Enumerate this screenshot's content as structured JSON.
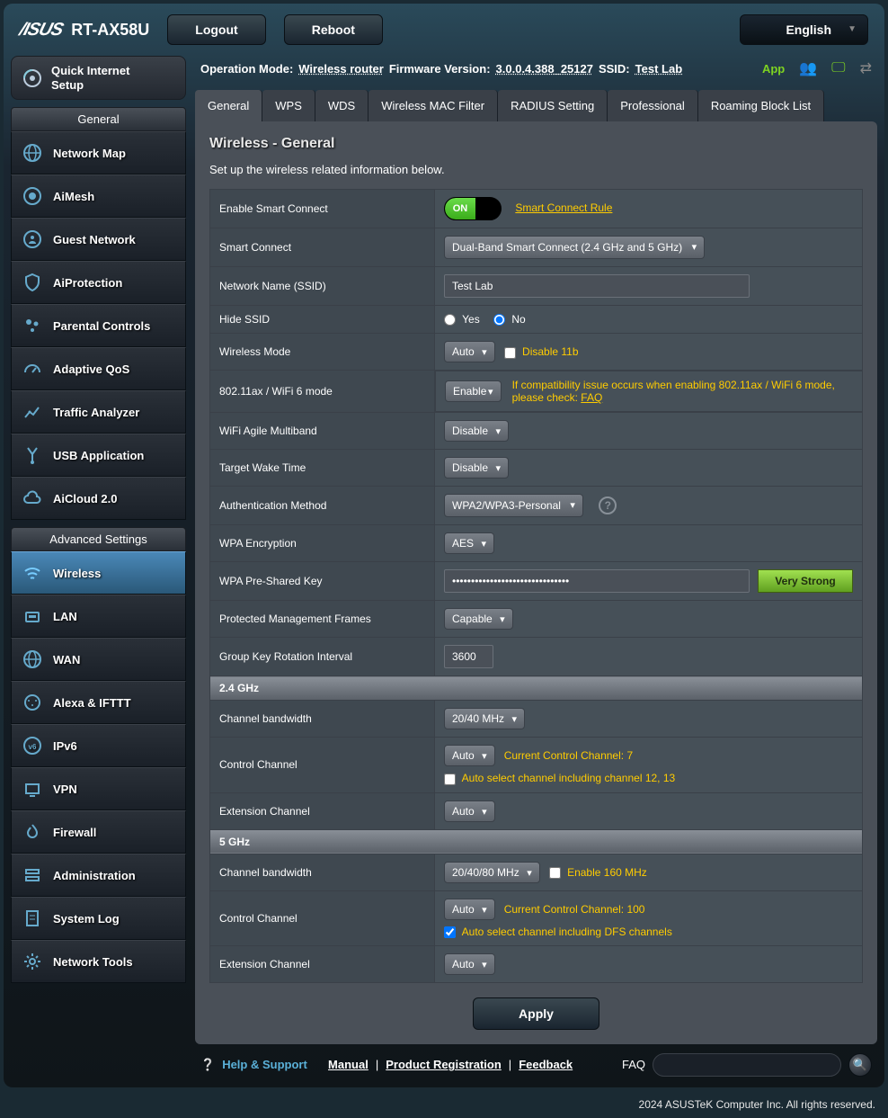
{
  "brand": "/ISUS",
  "model": "RT-AX58U",
  "top": {
    "logout": "Logout",
    "reboot": "Reboot",
    "language": "English"
  },
  "summary": {
    "op_mode_label": "Operation Mode:",
    "op_mode_value": "Wireless router",
    "fw_label": "Firmware Version:",
    "fw_value": "3.0.0.4.388_25127",
    "ssid_label": "SSID:",
    "ssid_value": "Test Lab",
    "app": "App"
  },
  "quick_setup": {
    "line1": "Quick Internet",
    "line2": "Setup"
  },
  "general_header": "General",
  "nav_general": [
    "Network Map",
    "AiMesh",
    "Guest Network",
    "AiProtection",
    "Parental Controls",
    "Adaptive QoS",
    "Traffic Analyzer",
    "USB Application",
    "AiCloud 2.0"
  ],
  "advanced_header": "Advanced Settings",
  "nav_advanced": [
    "Wireless",
    "LAN",
    "WAN",
    "Alexa & IFTTT",
    "IPv6",
    "VPN",
    "Firewall",
    "Administration",
    "System Log",
    "Network Tools"
  ],
  "tabs": [
    "General",
    "WPS",
    "WDS",
    "Wireless MAC Filter",
    "RADIUS Setting",
    "Professional",
    "Roaming Block List"
  ],
  "panel": {
    "title": "Wireless - General",
    "subtitle": "Set up the wireless related information below."
  },
  "form": {
    "enable_sc_label": "Enable Smart Connect",
    "enable_sc_on": "ON",
    "sc_rule_link": "Smart Connect Rule",
    "sc_label": "Smart Connect",
    "sc_value": "Dual-Band Smart Connect (2.4 GHz and 5 GHz)",
    "ssid_label": "Network Name (SSID)",
    "ssid_value": "Test Lab",
    "hide_label": "Hide SSID",
    "hide_yes": "Yes",
    "hide_no": "No",
    "wmode_label": "Wireless Mode",
    "wmode_value": "Auto",
    "disable_11b": "Disable 11b",
    "ax_label": "802.11ax / WiFi 6 mode",
    "ax_value": "Enable",
    "ax_note": "If compatibility issue occurs when enabling 802.11ax / WiFi 6 mode, please check: ",
    "ax_faq": "FAQ",
    "agile_label": "WiFi Agile Multiband",
    "agile_value": "Disable",
    "twt_label": "Target Wake Time",
    "twt_value": "Disable",
    "auth_label": "Authentication Method",
    "auth_value": "WPA2/WPA3-Personal",
    "enc_label": "WPA Encryption",
    "enc_value": "AES",
    "psk_label": "WPA Pre-Shared Key",
    "psk_value": "•••••••••••••••••••••••••••••••",
    "psk_strength": "Very Strong",
    "pmf_label": "Protected Management Frames",
    "pmf_value": "Capable",
    "gki_label": "Group Key Rotation Interval",
    "gki_value": "3600",
    "band24_header": "2.4 GHz",
    "cb24_label": "Channel bandwidth",
    "cb24_value": "20/40 MHz",
    "cc24_label": "Control Channel",
    "cc24_value": "Auto",
    "cc24_current": "Current Control Channel: 7",
    "cc24_chk": "Auto select channel including channel 12, 13",
    "ec24_label": "Extension Channel",
    "ec24_value": "Auto",
    "band5_header": "5 GHz",
    "cb5_label": "Channel bandwidth",
    "cb5_value": "20/40/80 MHz",
    "cb5_chk": "Enable 160 MHz",
    "cc5_label": "Control Channel",
    "cc5_value": "Auto",
    "cc5_current": "Current Control Channel: 100",
    "cc5_chk": "Auto select channel including DFS channels",
    "ec5_label": "Extension Channel",
    "ec5_value": "Auto",
    "apply": "Apply"
  },
  "footer": {
    "help": "Help & Support",
    "manual": "Manual",
    "product_reg": "Product Registration",
    "feedback": "Feedback",
    "faq": "FAQ"
  },
  "copyright": "2024 ASUSTeK Computer Inc. All rights reserved."
}
